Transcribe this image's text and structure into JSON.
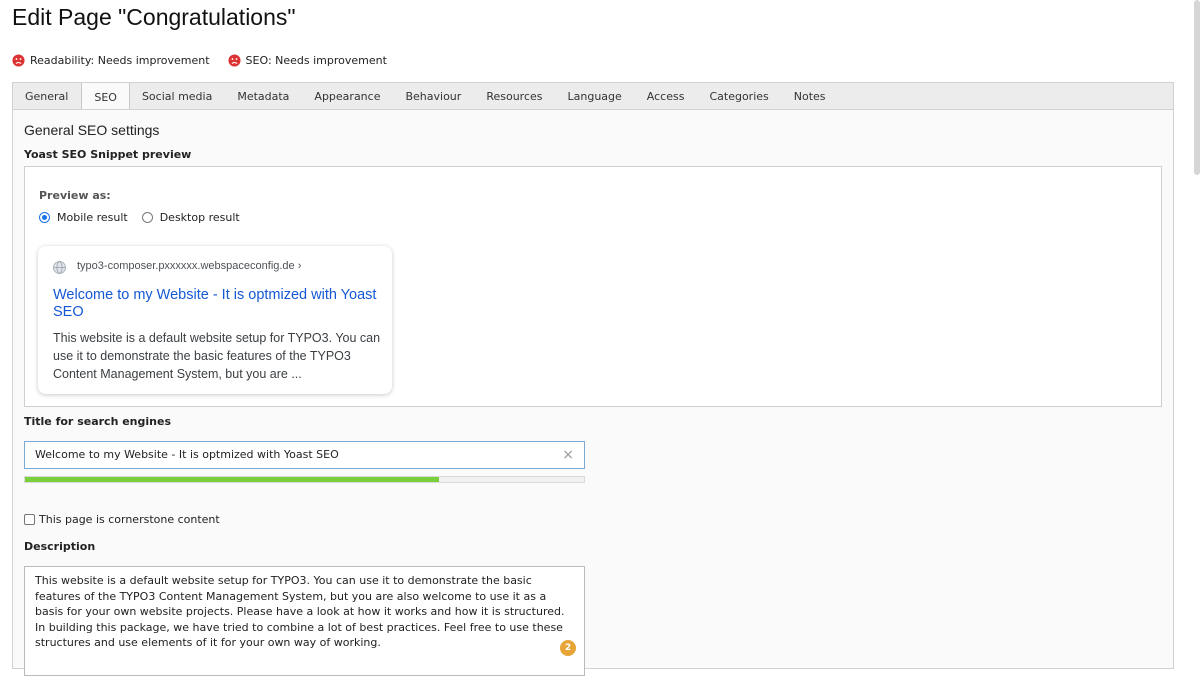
{
  "page_title": "Edit Page \"Congratulations\"",
  "ratings": {
    "readability": "Readability: Needs improvement",
    "seo": "SEO: Needs improvement",
    "bad_color": "#dc3232"
  },
  "tabs": [
    {
      "label": "General",
      "active": false
    },
    {
      "label": "SEO",
      "active": true
    },
    {
      "label": "Social media",
      "active": false
    },
    {
      "label": "Metadata",
      "active": false
    },
    {
      "label": "Appearance",
      "active": false
    },
    {
      "label": "Behaviour",
      "active": false
    },
    {
      "label": "Resources",
      "active": false
    },
    {
      "label": "Language",
      "active": false
    },
    {
      "label": "Access",
      "active": false
    },
    {
      "label": "Categories",
      "active": false
    },
    {
      "label": "Notes",
      "active": false
    }
  ],
  "seo": {
    "section_heading": "General SEO settings",
    "snippet_label": "Yoast SEO Snippet preview",
    "preview_as": "Preview as:",
    "mobile_label": "Mobile result",
    "desktop_label": "Desktop result",
    "selected_preview": "mobile",
    "serp": {
      "url": "typo3-composer.pxxxxxx.webspaceconfig.de ›",
      "title": "Welcome to my Website - It is optmized with Yoast SEO",
      "description": "This website is a default website setup for TYPO3. You can use it to demonstrate the basic features of the TYPO3 Content Management System, but you are ..."
    },
    "title_label": "Title for search engines",
    "title_value": "Welcome to my Website  - It is optmized with Yoast SEO",
    "title_progress_percent": 74,
    "title_progress_color": "#7ad03a",
    "cornerstone_label": "This page is cornerstone content",
    "cornerstone_checked": false,
    "description_label": "Description",
    "description_value": "This website is a default website setup for TYPO3. You can use it to demonstrate the basic features of the TYPO3 Content Management System, but you are also welcome to use it as a basis for your own website projects. Please have a look at how it works and how it is structured. In building this package, we have tried to combine a lot of best practices. Feel free to use these structures and use elements of it for your own way of working.",
    "description_badge": "2"
  }
}
